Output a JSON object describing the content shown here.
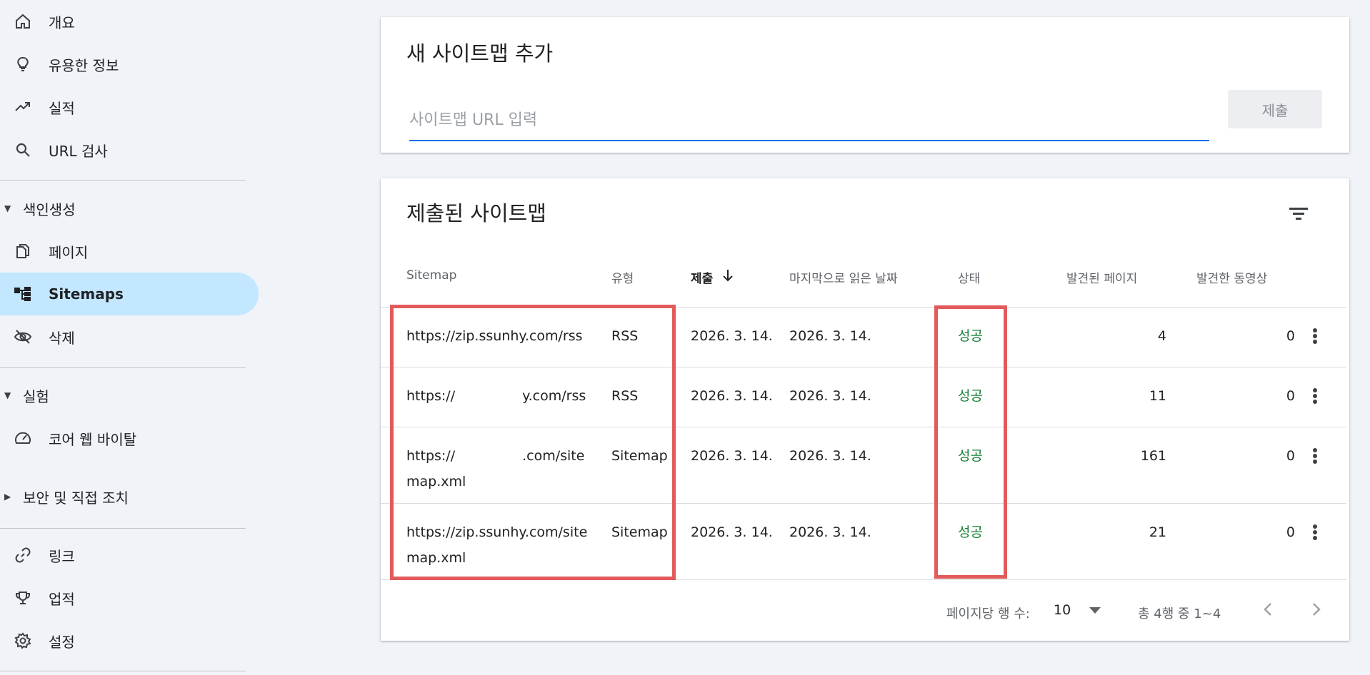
{
  "sidebar": {
    "top_items": [
      {
        "label": "개요",
        "icon": "home-icon"
      },
      {
        "label": "유용한 정보",
        "icon": "lightbulb-icon"
      },
      {
        "label": "실적",
        "icon": "trending-up-icon"
      },
      {
        "label": "URL 검사",
        "icon": "search-icon"
      }
    ],
    "indexing": {
      "label": "색인생성",
      "items": [
        {
          "label": "페이지",
          "icon": "pages-icon"
        },
        {
          "label": "Sitemaps",
          "icon": "sitemap-icon",
          "active": true
        },
        {
          "label": "삭제",
          "icon": "visibility-off-icon"
        }
      ]
    },
    "experiments": {
      "label": "실험",
      "items": [
        {
          "label": "코어 웹 바이탈",
          "icon": "speed-gauge-icon"
        }
      ]
    },
    "security": {
      "label": "보안 및 직접 조치"
    },
    "bottom_items": [
      {
        "label": "링크",
        "icon": "link-icon"
      },
      {
        "label": "업적",
        "icon": "trophy-icon"
      },
      {
        "label": "설정",
        "icon": "gear-icon"
      }
    ]
  },
  "add_card": {
    "title": "새 사이트맵 추가",
    "input_placeholder": "사이트맵 URL 입력",
    "input_value": "",
    "submit_label": "제출"
  },
  "submitted_card": {
    "title": "제출된 사이트맵",
    "columns": [
      "Sitemap",
      "유형",
      "제출",
      "마지막으로 읽은 날짜",
      "상태",
      "발견된 페이지",
      "발견한 동영상"
    ],
    "sorted_column": "제출",
    "rows": [
      {
        "sitemap_line1": "https://zip.ssunhy.com/rss",
        "sitemap_line2": "",
        "type": "RSS",
        "submitted": "2026. 3. 14.",
        "last_read": "2026. 3. 14.",
        "status": "성공",
        "pages": "4",
        "videos": "0"
      },
      {
        "sitemap_line1": "https://",
        "sitemap_line1_end": "y.com/rss",
        "sitemap_line2": "",
        "type": "RSS",
        "submitted": "2026. 3. 14.",
        "last_read": "2026. 3. 14.",
        "status": "성공",
        "pages": "11",
        "videos": "0"
      },
      {
        "sitemap_line1": "https://",
        "sitemap_line1_end": ".com/site",
        "sitemap_line2": "map.xml",
        "type": "Sitemap",
        "submitted": "2026. 3. 14.",
        "last_read": "2026. 3. 14.",
        "status": "성공",
        "pages": "161",
        "videos": "0"
      },
      {
        "sitemap_line1": "https://zip.ssunhy.com/site",
        "sitemap_line2": "map.xml",
        "type": "Sitemap",
        "submitted": "2026. 3. 14.",
        "last_read": "2026. 3. 14.",
        "status": "성공",
        "pages": "21",
        "videos": "0"
      }
    ],
    "footer": {
      "rows_per_page_label": "페이지당 행 수:",
      "rows_per_page_value": "10",
      "range_text": "총 4행 중 1~4"
    }
  },
  "colors": {
    "accent": "#1a73e8",
    "active_nav": "#c2e7ff",
    "success": "#188038",
    "highlight": "#e25b5b"
  }
}
